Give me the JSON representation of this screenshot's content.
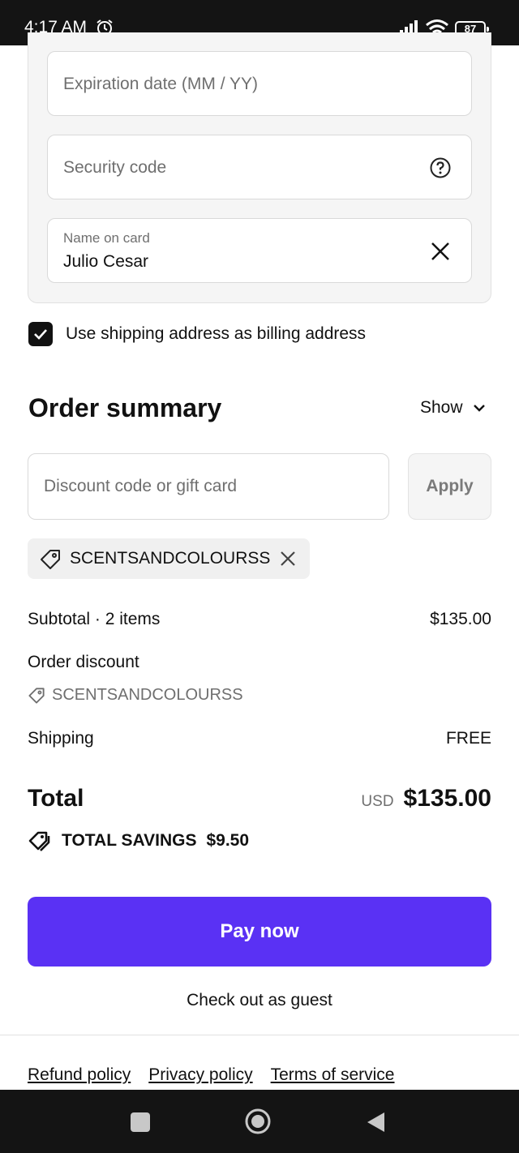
{
  "status_bar": {
    "time": "4:17 AM",
    "battery": "87"
  },
  "payment": {
    "expiration_placeholder": "Expiration date (MM / YY)",
    "security_placeholder": "Security code",
    "name_label": "Name on card",
    "name_value": "Julio Cesar"
  },
  "billing_checkbox": {
    "label": "Use shipping address as billing address",
    "checked": true
  },
  "order_summary": {
    "title": "Order summary",
    "toggle_label": "Show",
    "discount_placeholder": "Discount code or gift card",
    "apply_label": "Apply",
    "applied_code": "SCENTSANDCOLOURSS",
    "subtotal_label": "Subtotal · 2 items",
    "subtotal_value": "$135.00",
    "order_discount_label": "Order discount",
    "order_discount_code": "SCENTSANDCOLOURSS",
    "shipping_label": "Shipping",
    "shipping_value": "FREE",
    "total_label": "Total",
    "total_currency": "USD",
    "total_value": "$135.00",
    "savings_label": "TOTAL SAVINGS",
    "savings_value": "$9.50"
  },
  "actions": {
    "pay_now": "Pay now",
    "guest_checkout": "Check out as guest"
  },
  "footer": {
    "links": [
      "Refund policy",
      "Privacy policy",
      "Terms of service"
    ]
  },
  "colors": {
    "accent": "#5a31f4",
    "status_bar": "#141414"
  }
}
